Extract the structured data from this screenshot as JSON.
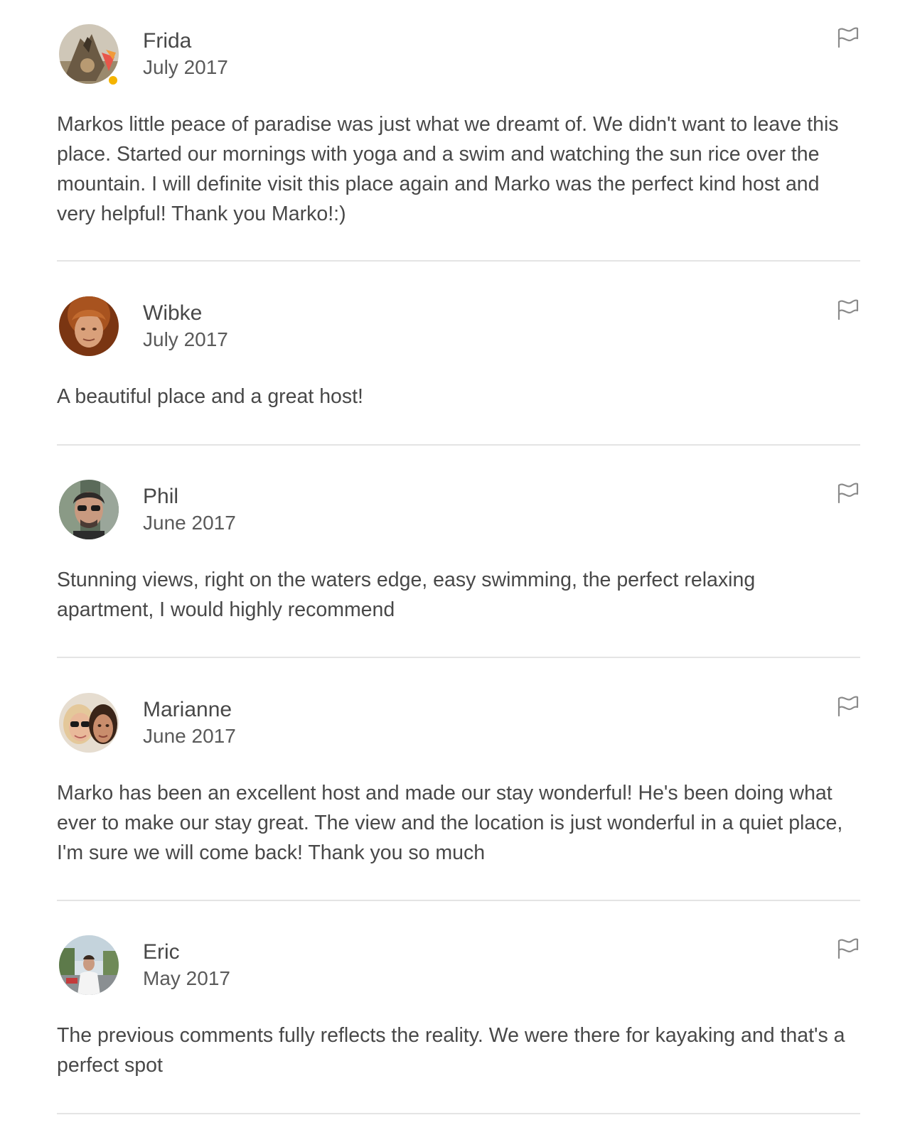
{
  "reviews": [
    {
      "name": "Frida",
      "date": "July 2017",
      "text": "Markos little peace of paradise was just what we dreamt of. We didn't want to leave this place. Started our mornings with yoga and a swim and watching the sun rice over the mountain. I will definite visit this place again and Marko was the perfect kind host and very helpful! Thank you Marko!:)",
      "superhost_badge": true,
      "flag_icon": "flag-icon"
    },
    {
      "name": "Wibke",
      "date": "July 2017",
      "text": "A beautiful place and a great host!",
      "flag_icon": "flag-icon"
    },
    {
      "name": "Phil",
      "date": "June 2017",
      "text": "Stunning views, right on the waters edge, easy swimming, the perfect relaxing apartment, I would highly recommend",
      "flag_icon": "flag-icon"
    },
    {
      "name": "Marianne",
      "date": "June 2017",
      "text": "Marko has been an excellent host and made our stay wonderful! He's been doing what ever to make our stay great. The view and the location is just wonderful in a quiet place, I'm sure we will come back! Thank you so much",
      "flag_icon": "flag-icon"
    },
    {
      "name": "Eric",
      "date": "May 2017",
      "text": "The previous comments fully reflects the reality. We were there for kayaking and that's a perfect spot",
      "flag_icon": "flag-icon"
    }
  ],
  "colors": {
    "text": "#484848",
    "divider": "#e4e4e4",
    "flag": "#8a8a8a",
    "badge": "#f5b400"
  }
}
